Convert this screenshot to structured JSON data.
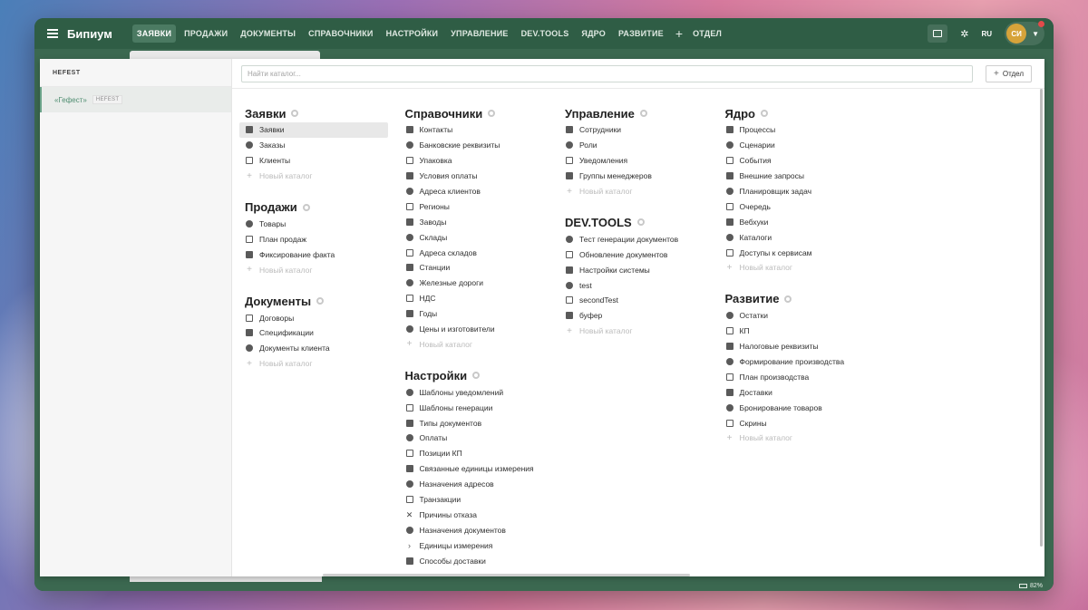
{
  "app": {
    "brand": "Бипиум"
  },
  "nav": {
    "items": [
      "ЗАЯВКИ",
      "ПРОДАЖИ",
      "ДОКУМЕНТЫ",
      "СПРАВОЧНИКИ",
      "НАСТРОЙКИ",
      "УПРАВЛЕНИЕ",
      "DEV.TOOLS",
      "ЯДРО",
      "РАЗВИТИЕ"
    ],
    "active_index": 0,
    "add_label": "ОТДЕЛ"
  },
  "header": {
    "lang": "RU",
    "avatar_initials": "СИ"
  },
  "sidebar": {
    "header": "HEFEST",
    "items": [
      {
        "name": "«Гефест»",
        "tag": "HEFEST"
      }
    ]
  },
  "search": {
    "placeholder": "Найти каталог..."
  },
  "toolbar": {
    "add_department": "Отдел"
  },
  "new_catalog_label": "Новый каталог",
  "status": {
    "battery": "82%"
  },
  "columns": [
    [
      {
        "title": "Заявки",
        "items": [
          "Заявки",
          "Заказы",
          "Клиенты"
        ],
        "new": true
      },
      {
        "title": "Продажи",
        "items": [
          "Товары",
          "План продаж",
          "Фиксирование факта"
        ],
        "new": true
      },
      {
        "title": "Документы",
        "items": [
          "Договоры",
          "Спецификации",
          "Документы клиента"
        ],
        "new": true
      }
    ],
    [
      {
        "title": "Справочники",
        "items": [
          "Контакты",
          "Банковские реквизиты",
          "Упаковка",
          "Условия оплаты",
          "Адреса клиентов",
          "Регионы",
          "Заводы",
          "Склады",
          "Адреса складов",
          "Станции",
          "Железные дороги",
          "НДС",
          "Годы",
          "Цены и изготовители"
        ],
        "new": true
      },
      {
        "title": "Настройки",
        "items": [
          "Шаблоны уведомлений",
          "Шаблоны генерации",
          "Типы документов",
          "Оплаты",
          "Позиции КП",
          "Связанные единицы измерения",
          "Назначения адресов",
          "Транзакции",
          "Причины отказа",
          "Назначения документов",
          "Единицы измерения",
          "Способы доставки"
        ],
        "new": false
      }
    ],
    [
      {
        "title": "Управление",
        "items": [
          "Сотрудники",
          "Роли",
          "Уведомления",
          "Группы менеджеров"
        ],
        "new": true
      },
      {
        "title": "DEV.TOOLS",
        "items": [
          "Тест генерации документов",
          "Обновление документов",
          "Настройки системы",
          "test",
          "secondTest",
          "буфер"
        ],
        "new": true
      }
    ],
    [
      {
        "title": "Ядро",
        "items": [
          "Процессы",
          "Сценарии",
          "События",
          "Внешние запросы",
          "Планировщик задач",
          "Очередь",
          "Вебхуки",
          "Каталоги",
          "Доступы к сервисам"
        ],
        "new": true
      },
      {
        "title": "Развитие",
        "items": [
          "Остатки",
          "КП",
          "Налоговые реквизиты",
          "Формирование производства",
          "План производства",
          "Доставки",
          "Бронирование товаров",
          "Скрины"
        ],
        "new": true
      }
    ]
  ]
}
